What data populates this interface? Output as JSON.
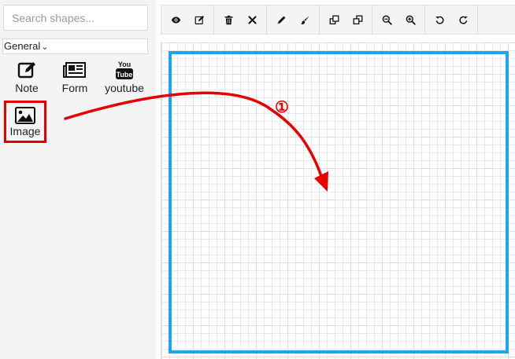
{
  "sidebar": {
    "search": {
      "placeholder": "Search shapes...",
      "value": ""
    },
    "category": {
      "selected": "General"
    },
    "shapes": [
      {
        "label": "Note",
        "icon": "note-edit-icon"
      },
      {
        "label": "Form",
        "icon": "newspaper-form-icon"
      },
      {
        "label": "youtube",
        "icon": "youtube-icon",
        "icon_text_top": "You",
        "icon_text_bottom": "Tube"
      },
      {
        "label": "Image",
        "icon": "image-icon",
        "highlighted": true
      }
    ]
  },
  "toolbar": {
    "buttons": [
      {
        "name": "preview",
        "icon": "eye-icon"
      },
      {
        "name": "edit",
        "icon": "edit-icon"
      },
      {
        "name": "delete",
        "icon": "trash-icon"
      },
      {
        "name": "clear",
        "icon": "close-icon"
      },
      {
        "name": "draw",
        "icon": "pencil-icon"
      },
      {
        "name": "brush",
        "icon": "brush-icon"
      },
      {
        "name": "bring-forward",
        "icon": "bring-forward-icon"
      },
      {
        "name": "send-backward",
        "icon": "send-backward-icon"
      },
      {
        "name": "zoom-out",
        "icon": "zoom-out-icon"
      },
      {
        "name": "zoom-in",
        "icon": "zoom-in-icon"
      },
      {
        "name": "undo",
        "icon": "undo-icon"
      },
      {
        "name": "redo",
        "icon": "redo-icon"
      }
    ]
  },
  "annotation": {
    "step": "①",
    "color": "#e60000"
  },
  "colors": {
    "highlight": "#e60000",
    "drop_frame": "#1ea5f0",
    "sidebar_bg": "#f4f4f4"
  }
}
